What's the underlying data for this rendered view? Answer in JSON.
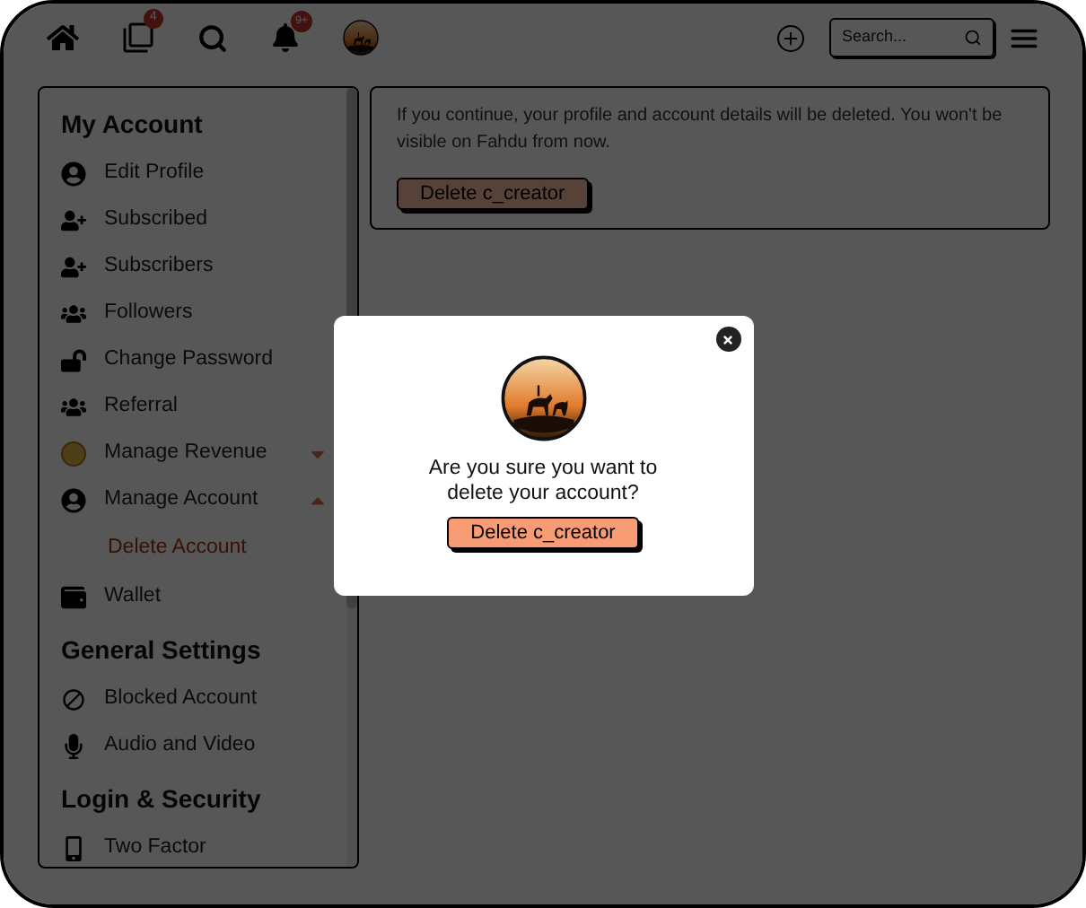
{
  "topbar": {
    "badges": [
      {
        "count": "4"
      },
      {
        "count": "9+"
      }
    ],
    "search": {
      "placeholder": "Search..."
    }
  },
  "sidebar": {
    "sections": [
      {
        "title": "My Account",
        "items": [
          {
            "label": "Edit Profile"
          },
          {
            "label": "Subscribed"
          },
          {
            "label": "Subscribers"
          },
          {
            "label": "Followers"
          },
          {
            "label": "Change Password"
          },
          {
            "label": "Referral"
          },
          {
            "label": "Manage Revenue",
            "expanded": false
          },
          {
            "label": "Manage Account",
            "expanded": true,
            "children": [
              {
                "label": "Delete Account",
                "selected": true
              }
            ]
          },
          {
            "label": "Wallet"
          }
        ]
      },
      {
        "title": "General Settings",
        "items": [
          {
            "label": "Blocked Account"
          },
          {
            "label": "Audio and Video"
          }
        ]
      },
      {
        "title": "Login & Security",
        "items": [
          {
            "label": "Two Factor"
          }
        ]
      }
    ]
  },
  "content": {
    "message": "If you continue, your profile and account details will be deleted. You won't be visible on Fahdu from now.",
    "button": "Delete c_creator"
  },
  "dialog": {
    "question": "Are you sure you want to delete your account?",
    "button": "Delete c_creator"
  }
}
